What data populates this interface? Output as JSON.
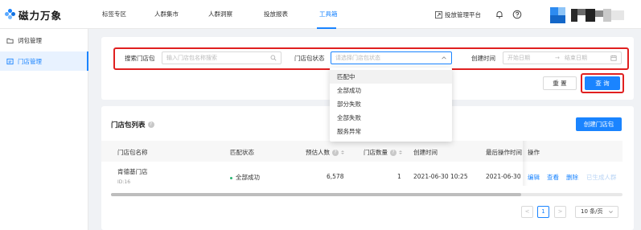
{
  "header": {
    "logo_text": "磁力万象",
    "nav": [
      {
        "label": "标签专区"
      },
      {
        "label": "人群集市"
      },
      {
        "label": "人群洞察"
      },
      {
        "label": "投放报表"
      },
      {
        "label": "工具箱",
        "active": true
      }
    ],
    "platform_label": "投放管理平台",
    "icons": [
      "launch-icon",
      "bell-icon",
      "help-icon"
    ]
  },
  "sidebar": {
    "items": [
      {
        "label": "词包管理",
        "icon": "folder-icon"
      },
      {
        "label": "门店管理",
        "icon": "store-icon",
        "active": true
      }
    ]
  },
  "search": {
    "store_package_label": "搜索门店包",
    "store_package_placeholder": "输入门店包名称搜索",
    "status_label": "门店包状态",
    "status_placeholder": "请选择门店包状态",
    "created_label": "创建时间",
    "start_placeholder": "开始日期",
    "date_arrow": "→",
    "end_placeholder": "结束日期",
    "reset_label": "重 置",
    "query_label": "查 询"
  },
  "status_options": [
    "匹配中",
    "全部成功",
    "部分失败",
    "全部失败",
    "服务异常"
  ],
  "list": {
    "title": "门店包列表",
    "create_label": "创建门店包",
    "columns": [
      "门店包名称",
      "匹配状态",
      "预估人数",
      "门店数量",
      "创建时间",
      "最后操作时间",
      "操作"
    ],
    "rows": [
      {
        "name": "肯德基门店",
        "id": "ID:16",
        "status": "全部成功",
        "estimated_people": "6,578",
        "store_count": "1",
        "created": "2021-06-30 10:25",
        "last_op": "2021-06-30",
        "actions": [
          "编辑",
          "查看",
          "删除",
          "已生成人群"
        ]
      }
    ]
  },
  "pagination": {
    "prev": "<",
    "page": "1",
    "next": ">",
    "page_size": "10 条/页"
  },
  "colors": {
    "accent": "#1a84ff",
    "highlight_border": "#e02020",
    "success": "#2bb673"
  }
}
